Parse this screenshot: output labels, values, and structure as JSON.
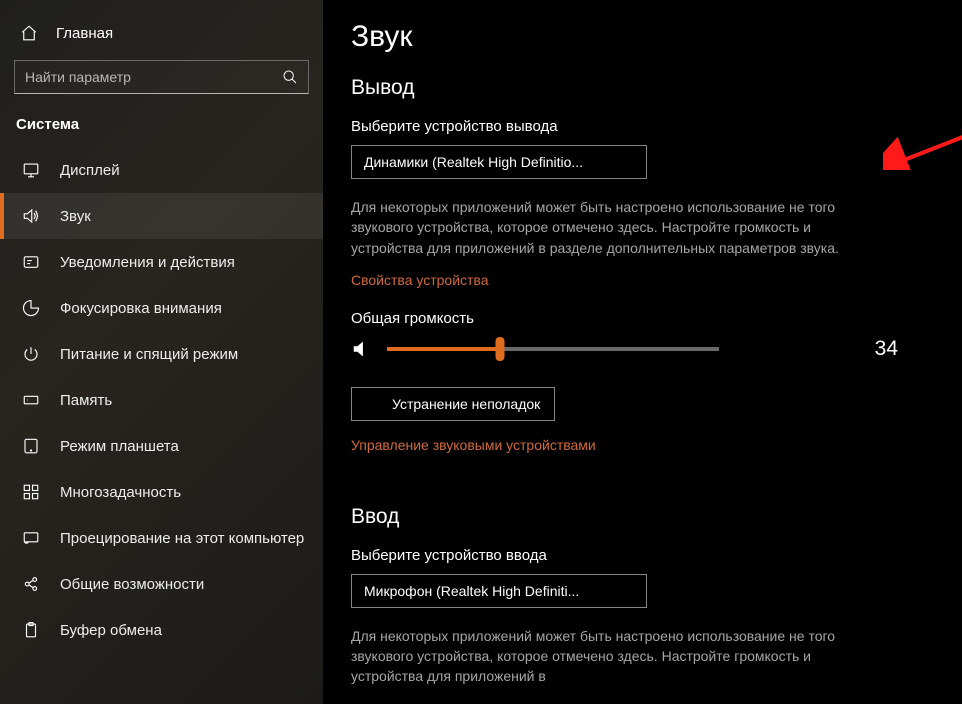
{
  "sidebar": {
    "home": "Главная",
    "search_placeholder": "Найти параметр",
    "category": "Система",
    "items": [
      {
        "id": "display",
        "label": "Дисплей",
        "active": false
      },
      {
        "id": "sound",
        "label": "Звук",
        "active": true
      },
      {
        "id": "notifications",
        "label": "Уведомления и действия",
        "active": false
      },
      {
        "id": "focus",
        "label": "Фокусировка внимания",
        "active": false
      },
      {
        "id": "power",
        "label": "Питание и спящий режим",
        "active": false
      },
      {
        "id": "storage",
        "label": "Память",
        "active": false
      },
      {
        "id": "tablet",
        "label": "Режим планшета",
        "active": false
      },
      {
        "id": "multitask",
        "label": "Многозадачность",
        "active": false
      },
      {
        "id": "projecting",
        "label": "Проецирование на этот компьютер",
        "active": false
      },
      {
        "id": "shared",
        "label": "Общие возможности",
        "active": false
      },
      {
        "id": "clipboard",
        "label": "Буфер обмена",
        "active": false
      }
    ]
  },
  "main": {
    "title": "Звук",
    "output": {
      "heading": "Вывод",
      "select_label": "Выберите устройство вывода",
      "select_value": "Динамики (Realtek High Definitio...",
      "desc": "Для некоторых приложений может быть настроено использование не того звукового устройства, которое отмечено здесь. Настройте громкость и устройства для приложений в разделе дополнительных параметров звука.",
      "props_link": "Свойства устройства",
      "volume_label": "Общая громкость",
      "volume_value": "34",
      "troubleshoot": "Устранение неполадок",
      "manage_link": "Управление звуковыми устройствами"
    },
    "input": {
      "heading": "Ввод",
      "select_label": "Выберите устройство ввода",
      "select_value": "Микрофон (Realtek High Definiti...",
      "desc": "Для некоторых приложений может быть настроено использование не того звукового устройства, которое отмечено здесь. Настройте громкость и устройства для приложений в"
    }
  }
}
